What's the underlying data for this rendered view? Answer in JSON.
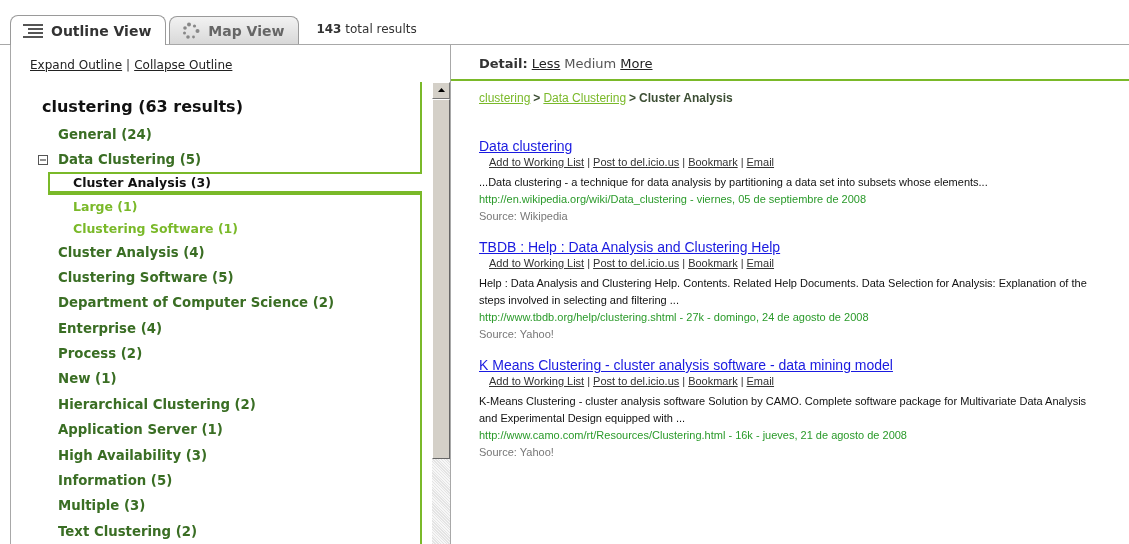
{
  "tabs": [
    {
      "label": "Outline View",
      "selected": true
    },
    {
      "label": "Map View",
      "selected": false
    }
  ],
  "total_results": "**143** total results",
  "outline_links": [
    {
      "kind": "link",
      "label": "Expand Outline"
    },
    {
      "kind": "separator",
      "label": "|"
    },
    {
      "kind": "link",
      "label": "Collapse Outline"
    }
  ],
  "tree": {
    "title": "clustering (63 results)",
    "items": [
      {
        "label": "General (24)",
        "selected": false
      },
      {
        "label": "Data Clustering (5)",
        "selected": false,
        "expanded": true,
        "children": [
          {
            "label": "Cluster Analysis (3)",
            "selected": true
          },
          {
            "label": "Large (1)",
            "selected": false
          },
          {
            "label": "Clustering Software (1)",
            "selected": false
          }
        ]
      },
      {
        "label": "Cluster Analysis (4)",
        "selected": false
      },
      {
        "label": "Clustering Software (5)",
        "selected": false
      },
      {
        "label": "Department of Computer Science (2)",
        "selected": false
      },
      {
        "label": "Enterprise (4)",
        "selected": false
      },
      {
        "label": "Process (2)",
        "selected": false
      },
      {
        "label": "New (1)",
        "selected": false
      },
      {
        "label": "Hierarchical Clustering (2)",
        "selected": false
      },
      {
        "label": "Application Server (1)",
        "selected": false
      },
      {
        "label": "High Availability (3)",
        "selected": false
      },
      {
        "label": "Information (5)",
        "selected": false
      },
      {
        "label": "Multiple (3)",
        "selected": false
      },
      {
        "label": "Text Clustering (2)",
        "selected": false
      }
    ]
  },
  "detail": {
    "label": "Detail:",
    "options": [
      {
        "label": "Less",
        "selected": false
      },
      {
        "label": "Medium",
        "selected": true
      },
      {
        "label": "More",
        "selected": false
      }
    ]
  },
  "breadcrumb": [
    {
      "kind": "link",
      "label": "clustering"
    },
    {
      "kind": "separator",
      "label": ">"
    },
    {
      "kind": "link",
      "label": "Data Clustering"
    },
    {
      "kind": "separator",
      "label": ">"
    },
    {
      "kind": "current",
      "label": "Cluster Analysis"
    }
  ],
  "results": [
    {
      "title": "Data clustering",
      "actions": [
        {
          "kind": "link",
          "label": "Add to Working List"
        },
        {
          "kind": "separator",
          "label": "|"
        },
        {
          "kind": "link",
          "label": "Post to del.icio.us"
        },
        {
          "kind": "separator",
          "label": "|"
        },
        {
          "kind": "link",
          "label": "Bookmark"
        },
        {
          "kind": "separator",
          "label": "|"
        },
        {
          "kind": "link",
          "label": "Email"
        }
      ],
      "snippet": "...Data clustering - a technique for data analysis by partitioning a data set into subsets whose elements...",
      "url": "http://en.wikipedia.org/wiki/Data_clustering - viernes, 05 de septiembre de 2008",
      "source": "Source: Wikipedia"
    },
    {
      "title": "TBDB : Help : Data Analysis and Clustering Help",
      "actions": [
        {
          "kind": "link",
          "label": "Add to Working List"
        },
        {
          "kind": "separator",
          "label": "|"
        },
        {
          "kind": "link",
          "label": "Post to del.icio.us"
        },
        {
          "kind": "separator",
          "label": "|"
        },
        {
          "kind": "link",
          "label": "Bookmark"
        },
        {
          "kind": "separator",
          "label": "|"
        },
        {
          "kind": "link",
          "label": "Email"
        }
      ],
      "snippet": "Help : Data Analysis and Clustering Help. Contents. Related Help Documents. Data Selection for Analysis: Explanation of the steps involved in selecting and filtering ...",
      "url": "http://www.tbdb.org/help/clustering.shtml - 27k - domingo, 24 de agosto de 2008",
      "source": "Source: Yahoo!"
    },
    {
      "title": "K Means Clustering - cluster analysis software - data mining model",
      "actions": [
        {
          "kind": "link",
          "label": "Add to Working List"
        },
        {
          "kind": "separator",
          "label": "|"
        },
        {
          "kind": "link",
          "label": "Post to del.icio.us"
        },
        {
          "kind": "separator",
          "label": "|"
        },
        {
          "kind": "link",
          "label": "Bookmark"
        },
        {
          "kind": "separator",
          "label": "|"
        },
        {
          "kind": "link",
          "label": "Email"
        }
      ],
      "snippet": "K-Means Clustering - cluster analysis software Solution by CAMO. Complete software package for Multivariate Data Analysis and Experimental Design equipped with ...",
      "url": "http://www.camo.com/rt/Resources/Clustering.html - 16k - jueves, 21 de agosto de 2008",
      "source": "Source: Yahoo!"
    }
  ]
}
